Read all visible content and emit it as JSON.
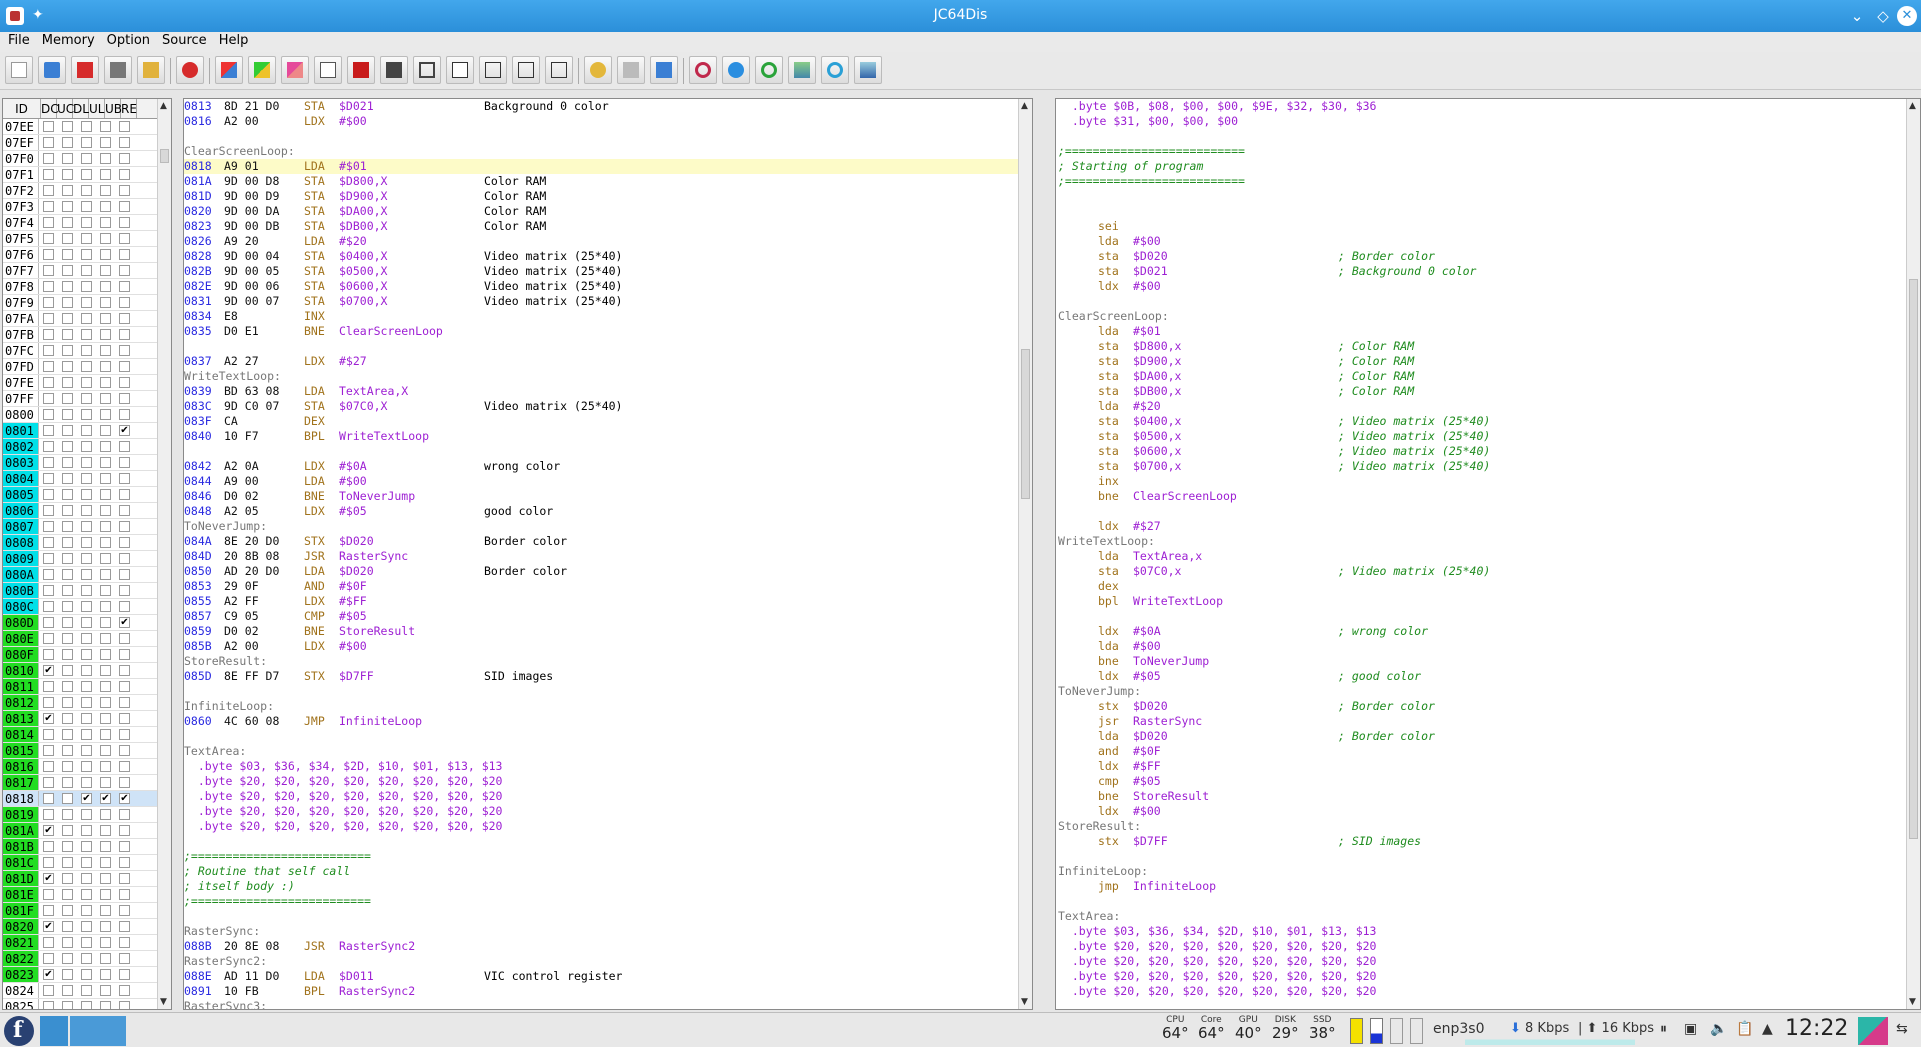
{
  "window": {
    "title": "JC64Dis"
  },
  "menu": [
    "File",
    "Memory",
    "Option",
    "Source",
    "Help"
  ],
  "id_panel": {
    "headers": [
      "ID",
      "DC",
      "UC",
      "DL",
      "UL",
      "UB",
      "RE"
    ],
    "rows": [
      {
        "id": "07EE",
        "c": "",
        "checks": [
          0,
          0,
          0,
          0,
          0
        ]
      },
      {
        "id": "07EF",
        "c": "",
        "checks": [
          0,
          0,
          0,
          0,
          0
        ]
      },
      {
        "id": "07F0",
        "c": "",
        "checks": [
          0,
          0,
          0,
          0,
          0
        ]
      },
      {
        "id": "07F1",
        "c": "",
        "checks": [
          0,
          0,
          0,
          0,
          0
        ]
      },
      {
        "id": "07F2",
        "c": "",
        "checks": [
          0,
          0,
          0,
          0,
          0
        ]
      },
      {
        "id": "07F3",
        "c": "",
        "checks": [
          0,
          0,
          0,
          0,
          0
        ]
      },
      {
        "id": "07F4",
        "c": "",
        "checks": [
          0,
          0,
          0,
          0,
          0
        ]
      },
      {
        "id": "07F5",
        "c": "",
        "checks": [
          0,
          0,
          0,
          0,
          0
        ]
      },
      {
        "id": "07F6",
        "c": "",
        "checks": [
          0,
          0,
          0,
          0,
          0
        ]
      },
      {
        "id": "07F7",
        "c": "",
        "checks": [
          0,
          0,
          0,
          0,
          0
        ]
      },
      {
        "id": "07F8",
        "c": "",
        "checks": [
          0,
          0,
          0,
          0,
          0
        ]
      },
      {
        "id": "07F9",
        "c": "",
        "checks": [
          0,
          0,
          0,
          0,
          0
        ]
      },
      {
        "id": "07FA",
        "c": "",
        "checks": [
          0,
          0,
          0,
          0,
          0
        ]
      },
      {
        "id": "07FB",
        "c": "",
        "checks": [
          0,
          0,
          0,
          0,
          0
        ]
      },
      {
        "id": "07FC",
        "c": "",
        "checks": [
          0,
          0,
          0,
          0,
          0
        ]
      },
      {
        "id": "07FD",
        "c": "",
        "checks": [
          0,
          0,
          0,
          0,
          0
        ]
      },
      {
        "id": "07FE",
        "c": "",
        "checks": [
          0,
          0,
          0,
          0,
          0
        ]
      },
      {
        "id": "07FF",
        "c": "",
        "checks": [
          0,
          0,
          0,
          0,
          0
        ]
      },
      {
        "id": "0800",
        "c": "",
        "checks": [
          0,
          0,
          0,
          0,
          0
        ]
      },
      {
        "id": "0801",
        "c": "#00e0e8",
        "checks": [
          0,
          0,
          0,
          0,
          1
        ]
      },
      {
        "id": "0802",
        "c": "#00e0e8",
        "checks": [
          0,
          0,
          0,
          0,
          0
        ]
      },
      {
        "id": "0803",
        "c": "#00e0e8",
        "checks": [
          0,
          0,
          0,
          0,
          0
        ]
      },
      {
        "id": "0804",
        "c": "#00e0e8",
        "checks": [
          0,
          0,
          0,
          0,
          0
        ]
      },
      {
        "id": "0805",
        "c": "#00e0e8",
        "checks": [
          0,
          0,
          0,
          0,
          0
        ]
      },
      {
        "id": "0806",
        "c": "#00e0e8",
        "checks": [
          0,
          0,
          0,
          0,
          0
        ]
      },
      {
        "id": "0807",
        "c": "#00e0e8",
        "checks": [
          0,
          0,
          0,
          0,
          0
        ]
      },
      {
        "id": "0808",
        "c": "#00e0e8",
        "checks": [
          0,
          0,
          0,
          0,
          0
        ]
      },
      {
        "id": "0809",
        "c": "#00e0e8",
        "checks": [
          0,
          0,
          0,
          0,
          0
        ]
      },
      {
        "id": "080A",
        "c": "#00e0e8",
        "checks": [
          0,
          0,
          0,
          0,
          0
        ]
      },
      {
        "id": "080B",
        "c": "#00e0e8",
        "checks": [
          0,
          0,
          0,
          0,
          0
        ]
      },
      {
        "id": "080C",
        "c": "#00e0e8",
        "checks": [
          0,
          0,
          0,
          0,
          0
        ]
      },
      {
        "id": "080D",
        "c": "#22dd22",
        "checks": [
          0,
          0,
          0,
          0,
          1
        ]
      },
      {
        "id": "080E",
        "c": "#22dd22",
        "checks": [
          0,
          0,
          0,
          0,
          0
        ]
      },
      {
        "id": "080F",
        "c": "#22dd22",
        "checks": [
          0,
          0,
          0,
          0,
          0
        ]
      },
      {
        "id": "0810",
        "c": "#22dd22",
        "checks": [
          1,
          0,
          0,
          0,
          0
        ]
      },
      {
        "id": "0811",
        "c": "#22dd22",
        "checks": [
          0,
          0,
          0,
          0,
          0
        ]
      },
      {
        "id": "0812",
        "c": "#22dd22",
        "checks": [
          0,
          0,
          0,
          0,
          0
        ]
      },
      {
        "id": "0813",
        "c": "#22dd22",
        "checks": [
          1,
          0,
          0,
          0,
          0
        ]
      },
      {
        "id": "0814",
        "c": "#22dd22",
        "checks": [
          0,
          0,
          0,
          0,
          0
        ]
      },
      {
        "id": "0815",
        "c": "#22dd22",
        "checks": [
          0,
          0,
          0,
          0,
          0
        ]
      },
      {
        "id": "0816",
        "c": "#22dd22",
        "checks": [
          0,
          0,
          0,
          0,
          0
        ]
      },
      {
        "id": "0817",
        "c": "#22dd22",
        "checks": [
          0,
          0,
          0,
          0,
          0
        ]
      },
      {
        "id": "0818",
        "c": "#cfe3f7",
        "checks": [
          0,
          0,
          1,
          1,
          1
        ],
        "sel": true
      },
      {
        "id": "0819",
        "c": "#22dd22",
        "checks": [
          0,
          0,
          0,
          0,
          0
        ]
      },
      {
        "id": "081A",
        "c": "#22dd22",
        "checks": [
          1,
          0,
          0,
          0,
          0
        ]
      },
      {
        "id": "081B",
        "c": "#22dd22",
        "checks": [
          0,
          0,
          0,
          0,
          0
        ]
      },
      {
        "id": "081C",
        "c": "#22dd22",
        "checks": [
          0,
          0,
          0,
          0,
          0
        ]
      },
      {
        "id": "081D",
        "c": "#22dd22",
        "checks": [
          1,
          0,
          0,
          0,
          0
        ]
      },
      {
        "id": "081E",
        "c": "#22dd22",
        "checks": [
          0,
          0,
          0,
          0,
          0
        ]
      },
      {
        "id": "081F",
        "c": "#22dd22",
        "checks": [
          0,
          0,
          0,
          0,
          0
        ]
      },
      {
        "id": "0820",
        "c": "#22dd22",
        "checks": [
          1,
          0,
          0,
          0,
          0
        ]
      },
      {
        "id": "0821",
        "c": "#22dd22",
        "checks": [
          0,
          0,
          0,
          0,
          0
        ]
      },
      {
        "id": "0822",
        "c": "#22dd22",
        "checks": [
          0,
          0,
          0,
          0,
          0
        ]
      },
      {
        "id": "0823",
        "c": "#22dd22",
        "checks": [
          1,
          0,
          0,
          0,
          0
        ]
      },
      {
        "id": "0824",
        "c": "",
        "checks": [
          0,
          0,
          0,
          0,
          0
        ]
      },
      {
        "id": "0825",
        "c": "",
        "checks": [
          0,
          0,
          0,
          0,
          0
        ]
      }
    ]
  },
  "disassembly": [
    {
      "a": "0813",
      "b": "8D 21 D0",
      "m": "STA",
      "o": "$D021",
      "c": "Background 0 color"
    },
    {
      "a": "0816",
      "b": "A2 00",
      "m": "LDX",
      "o": "#$00",
      "c": ""
    },
    {
      "t": "blank"
    },
    {
      "t": "label",
      "text": "ClearScreenLoop:"
    },
    {
      "a": "0818",
      "b": "A9 01",
      "m": "LDA",
      "o": "#$01",
      "c": "",
      "hl": true
    },
    {
      "a": "081A",
      "b": "9D 00 D8",
      "m": "STA",
      "o": "$D800,X",
      "c": "Color RAM"
    },
    {
      "a": "081D",
      "b": "9D 00 D9",
      "m": "STA",
      "o": "$D900,X",
      "c": "Color RAM"
    },
    {
      "a": "0820",
      "b": "9D 00 DA",
      "m": "STA",
      "o": "$DA00,X",
      "c": "Color RAM"
    },
    {
      "a": "0823",
      "b": "9D 00 DB",
      "m": "STA",
      "o": "$DB00,X",
      "c": "Color RAM"
    },
    {
      "a": "0826",
      "b": "A9 20",
      "m": "LDA",
      "o": "#$20",
      "c": ""
    },
    {
      "a": "0828",
      "b": "9D 00 04",
      "m": "STA",
      "o": "$0400,X",
      "c": "Video matrix (25*40)"
    },
    {
      "a": "082B",
      "b": "9D 00 05",
      "m": "STA",
      "o": "$0500,X",
      "c": "Video matrix (25*40)"
    },
    {
      "a": "082E",
      "b": "9D 00 06",
      "m": "STA",
      "o": "$0600,X",
      "c": "Video matrix (25*40)"
    },
    {
      "a": "0831",
      "b": "9D 00 07",
      "m": "STA",
      "o": "$0700,X",
      "c": "Video matrix (25*40)"
    },
    {
      "a": "0834",
      "b": "E8",
      "m": "INX",
      "o": "",
      "c": ""
    },
    {
      "a": "0835",
      "b": "D0 E1",
      "m": "BNE",
      "o": "ClearScreenLoop",
      "c": ""
    },
    {
      "t": "blank"
    },
    {
      "a": "0837",
      "b": "A2 27",
      "m": "LDX",
      "o": "#$27",
      "c": ""
    },
    {
      "t": "label",
      "text": "WriteTextLoop:"
    },
    {
      "a": "0839",
      "b": "BD 63 08",
      "m": "LDA",
      "o": "TextArea,X",
      "c": ""
    },
    {
      "a": "083C",
      "b": "9D C0 07",
      "m": "STA",
      "o": "$07C0,X",
      "c": "Video matrix (25*40)"
    },
    {
      "a": "083F",
      "b": "CA",
      "m": "DEX",
      "o": "",
      "c": ""
    },
    {
      "a": "0840",
      "b": "10 F7",
      "m": "BPL",
      "o": "WriteTextLoop",
      "c": ""
    },
    {
      "t": "blank"
    },
    {
      "a": "0842",
      "b": "A2 0A",
      "m": "LDX",
      "o": "#$0A",
      "c": "wrong color"
    },
    {
      "a": "0844",
      "b": "A9 00",
      "m": "LDA",
      "o": "#$00",
      "c": ""
    },
    {
      "a": "0846",
      "b": "D0 02",
      "m": "BNE",
      "o": "ToNeverJump",
      "c": ""
    },
    {
      "a": "0848",
      "b": "A2 05",
      "m": "LDX",
      "o": "#$05",
      "c": "good color"
    },
    {
      "t": "label",
      "text": "ToNeverJump:"
    },
    {
      "a": "084A",
      "b": "8E 20 D0",
      "m": "STX",
      "o": "$D020",
      "c": "Border color"
    },
    {
      "a": "084D",
      "b": "20 8B 08",
      "m": "JSR",
      "o": "RasterSync",
      "c": ""
    },
    {
      "a": "0850",
      "b": "AD 20 D0",
      "m": "LDA",
      "o": "$D020",
      "c": "Border color"
    },
    {
      "a": "0853",
      "b": "29 0F",
      "m": "AND",
      "o": "#$0F",
      "c": ""
    },
    {
      "a": "0855",
      "b": "A2 FF",
      "m": "LDX",
      "o": "#$FF",
      "c": ""
    },
    {
      "a": "0857",
      "b": "C9 05",
      "m": "CMP",
      "o": "#$05",
      "c": ""
    },
    {
      "a": "0859",
      "b": "D0 02",
      "m": "BNE",
      "o": "StoreResult",
      "c": ""
    },
    {
      "a": "085B",
      "b": "A2 00",
      "m": "LDX",
      "o": "#$00",
      "c": ""
    },
    {
      "t": "label",
      "text": "StoreResult:"
    },
    {
      "a": "085D",
      "b": "8E FF D7",
      "m": "STX",
      "o": "$D7FF",
      "c": "SID images"
    },
    {
      "t": "blank"
    },
    {
      "t": "label",
      "text": "InfiniteLoop:"
    },
    {
      "a": "0860",
      "b": "4C 60 08",
      "m": "JMP",
      "o": "InfiniteLoop",
      "c": ""
    },
    {
      "t": "blank"
    },
    {
      "t": "label",
      "text": "TextArea:"
    },
    {
      "t": "bytes",
      "text": "  .byte $03, $36, $34, $2D, $10, $01, $13, $13"
    },
    {
      "t": "bytes",
      "text": "  .byte $20, $20, $20, $20, $20, $20, $20, $20"
    },
    {
      "t": "bytes",
      "text": "  .byte $20, $20, $20, $20, $20, $20, $20, $20"
    },
    {
      "t": "bytes",
      "text": "  .byte $20, $20, $20, $20, $20, $20, $20, $20"
    },
    {
      "t": "bytes",
      "text": "  .byte $20, $20, $20, $20, $20, $20, $20, $20"
    },
    {
      "t": "blank"
    },
    {
      "t": "comment",
      "text": ";=========================="
    },
    {
      "t": "comment",
      "text": "; Routine that self call"
    },
    {
      "t": "comment",
      "text": "; itself body :)"
    },
    {
      "t": "comment",
      "text": ";=========================="
    },
    {
      "t": "blank"
    },
    {
      "t": "label",
      "text": "RasterSync:"
    },
    {
      "a": "088B",
      "b": "20 8E 08",
      "m": "JSR",
      "o": "RasterSync2",
      "c": ""
    },
    {
      "t": "label",
      "text": "RasterSync2:"
    },
    {
      "a": "088E",
      "b": "AD 11 D0",
      "m": "LDA",
      "o": "$D011",
      "c": "VIC control register"
    },
    {
      "a": "0891",
      "b": "10 FB",
      "m": "BPL",
      "o": "RasterSync2",
      "c": ""
    },
    {
      "t": "label",
      "text": "RasterSync3:"
    }
  ],
  "source": [
    {
      "t": "bytes",
      "text": "  .byte $0B, $08, $00, $00, $9E, $32, $30, $36"
    },
    {
      "t": "bytes",
      "text": "  .byte $31, $00, $00, $00"
    },
    {
      "t": "blank"
    },
    {
      "t": "comment",
      "text": ";=========================="
    },
    {
      "t": "comment",
      "text": "; Starting of program"
    },
    {
      "t": "comment",
      "text": ";=========================="
    },
    {
      "t": "blank"
    },
    {
      "t": "blank"
    },
    {
      "m": "sei",
      "o": "",
      "c": ""
    },
    {
      "m": "lda",
      "o": "#$00",
      "c": ""
    },
    {
      "m": "sta",
      "o": "$D020",
      "c": "; Border color"
    },
    {
      "m": "sta",
      "o": "$D021",
      "c": "; Background 0 color"
    },
    {
      "m": "ldx",
      "o": "#$00",
      "c": ""
    },
    {
      "t": "blank"
    },
    {
      "t": "label",
      "text": "ClearScreenLoop:"
    },
    {
      "m": "lda",
      "o": "#$01",
      "c": ""
    },
    {
      "m": "sta",
      "o": "$D800,x",
      "c": "; Color RAM"
    },
    {
      "m": "sta",
      "o": "$D900,x",
      "c": "; Color RAM"
    },
    {
      "m": "sta",
      "o": "$DA00,x",
      "c": "; Color RAM"
    },
    {
      "m": "sta",
      "o": "$DB00,x",
      "c": "; Color RAM"
    },
    {
      "m": "lda",
      "o": "#$20",
      "c": ""
    },
    {
      "m": "sta",
      "o": "$0400,x",
      "c": "; Video matrix (25*40)"
    },
    {
      "m": "sta",
      "o": "$0500,x",
      "c": "; Video matrix (25*40)"
    },
    {
      "m": "sta",
      "o": "$0600,x",
      "c": "; Video matrix (25*40)"
    },
    {
      "m": "sta",
      "o": "$0700,x",
      "c": "; Video matrix (25*40)"
    },
    {
      "m": "inx",
      "o": "",
      "c": ""
    },
    {
      "m": "bne",
      "o": "ClearScreenLoop",
      "c": ""
    },
    {
      "t": "blank"
    },
    {
      "m": "ldx",
      "o": "#$27",
      "c": ""
    },
    {
      "t": "label",
      "text": "WriteTextLoop:"
    },
    {
      "m": "lda",
      "o": "TextArea,x",
      "c": ""
    },
    {
      "m": "sta",
      "o": "$07C0,x",
      "c": "; Video matrix (25*40)"
    },
    {
      "m": "dex",
      "o": "",
      "c": ""
    },
    {
      "m": "bpl",
      "o": "WriteTextLoop",
      "c": ""
    },
    {
      "t": "blank"
    },
    {
      "m": "ldx",
      "o": "#$0A",
      "c": "; wrong color"
    },
    {
      "m": "lda",
      "o": "#$00",
      "c": ""
    },
    {
      "m": "bne",
      "o": "ToNeverJump",
      "c": ""
    },
    {
      "m": "ldx",
      "o": "#$05",
      "c": "; good color"
    },
    {
      "t": "label",
      "text": "ToNeverJump:"
    },
    {
      "m": "stx",
      "o": "$D020",
      "c": "; Border color"
    },
    {
      "m": "jsr",
      "o": "RasterSync",
      "c": ""
    },
    {
      "m": "lda",
      "o": "$D020",
      "c": "; Border color"
    },
    {
      "m": "and",
      "o": "#$0F",
      "c": ""
    },
    {
      "m": "ldx",
      "o": "#$FF",
      "c": ""
    },
    {
      "m": "cmp",
      "o": "#$05",
      "c": ""
    },
    {
      "m": "bne",
      "o": "StoreResult",
      "c": ""
    },
    {
      "m": "ldx",
      "o": "#$00",
      "c": ""
    },
    {
      "t": "label",
      "text": "StoreResult:"
    },
    {
      "m": "stx",
      "o": "$D7FF",
      "c": "; SID images"
    },
    {
      "t": "blank"
    },
    {
      "t": "label",
      "text": "InfiniteLoop:"
    },
    {
      "m": "jmp",
      "o": "InfiniteLoop",
      "c": ""
    },
    {
      "t": "blank"
    },
    {
      "t": "label",
      "text": "TextArea:"
    },
    {
      "t": "bytes",
      "text": "  .byte $03, $36, $34, $2D, $10, $01, $13, $13"
    },
    {
      "t": "bytes",
      "text": "  .byte $20, $20, $20, $20, $20, $20, $20, $20"
    },
    {
      "t": "bytes",
      "text": "  .byte $20, $20, $20, $20, $20, $20, $20, $20"
    },
    {
      "t": "bytes",
      "text": "  .byte $20, $20, $20, $20, $20, $20, $20, $20"
    },
    {
      "t": "bytes",
      "text": "  .byte $20, $20, $20, $20, $20, $20, $20, $20"
    }
  ],
  "taskbar": {
    "sensors": [
      {
        "label": "CPU",
        "value": "64°"
      },
      {
        "label": "Core",
        "value": "64°"
      },
      {
        "label": "GPU",
        "value": "40°"
      },
      {
        "label": "DISK",
        "value": "29°"
      },
      {
        "label": "SSD",
        "value": "38°"
      }
    ],
    "network_interface": "enp3s0",
    "download": "8 Kbps",
    "upload": "16 Kbps",
    "clock": "12:22"
  }
}
